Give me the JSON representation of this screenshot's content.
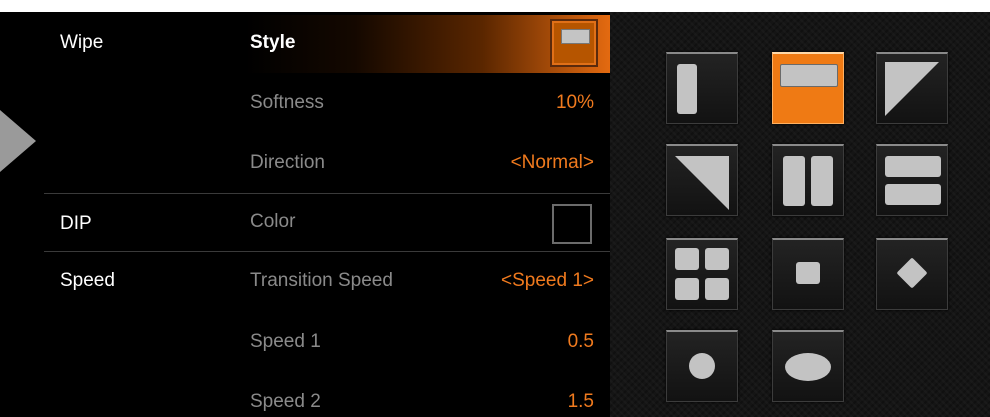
{
  "categories": {
    "wipe": "Wipe",
    "dip": "DIP",
    "speed": "Speed"
  },
  "settings": [
    {
      "label": "Style",
      "value": ""
    },
    {
      "label": "Softness",
      "value": "10%"
    },
    {
      "label": "Direction",
      "value": "<Normal>"
    },
    {
      "label": "Color",
      "value": ""
    },
    {
      "label": "Transition Speed",
      "value": "<Speed 1>"
    },
    {
      "label": "Speed 1",
      "value": "0.5"
    },
    {
      "label": "Speed 2",
      "value": "1.5"
    }
  ],
  "wipe_styles": [
    {
      "icon": "vertical-bar-wipe-icon",
      "selected": false
    },
    {
      "icon": "horizontal-bar-wipe-icon",
      "selected": true
    },
    {
      "icon": "top-right-triangle-wipe-icon",
      "selected": false
    },
    {
      "icon": "bottom-left-triangle-wipe-icon",
      "selected": false
    },
    {
      "icon": "vertical-split-wipe-icon",
      "selected": false
    },
    {
      "icon": "horizontal-split-wipe-icon",
      "selected": false
    },
    {
      "icon": "four-squares-wipe-icon",
      "selected": false
    },
    {
      "icon": "square-wipe-icon",
      "selected": false
    },
    {
      "icon": "diamond-wipe-icon",
      "selected": false
    },
    {
      "icon": "circle-wipe-icon",
      "selected": false
    },
    {
      "icon": "ellipse-wipe-icon",
      "selected": false
    }
  ],
  "colors": {
    "accent": "#f07a1e",
    "selected_tile": "#ef7a14",
    "label_dim": "#8a8a8a",
    "background": "#000000"
  }
}
